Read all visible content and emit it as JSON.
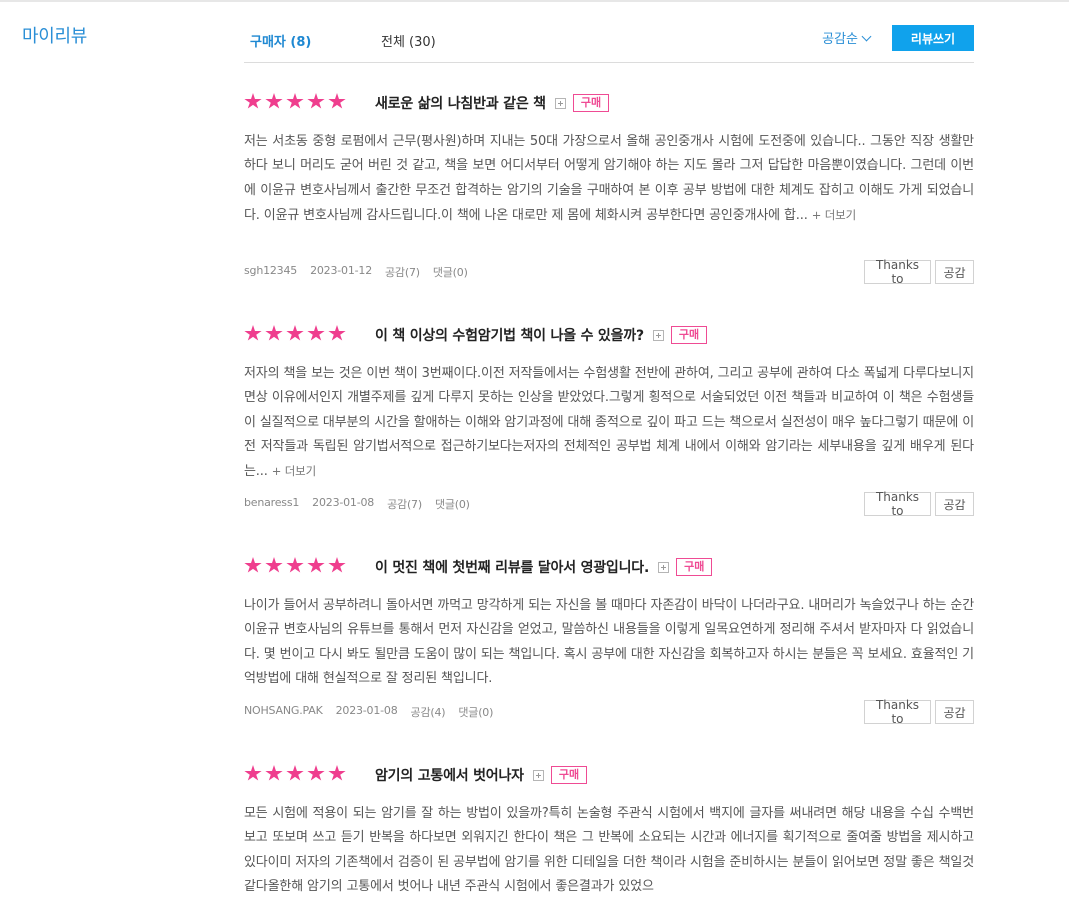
{
  "sidebar": {
    "title": "마이리뷰"
  },
  "tabs": [
    {
      "label": "구매자 (8)"
    },
    {
      "label": "전체 (30)"
    }
  ],
  "sort_label": "공감순",
  "write_button": "리뷰쓰기",
  "buttons": {
    "thanks": "Thanks to",
    "like": "공감"
  },
  "more_label": "+ 더보기",
  "colors": {
    "accent": "#10a2ec",
    "link": "#2b8fd6",
    "star": "#ef3e8e",
    "badge": "#ef4b94"
  },
  "reviews": [
    {
      "rating": 5,
      "title": "새로운 삶의 나침반과 같은 책",
      "badge": "구매",
      "body": "저는 서초동 중형 로펌에서 근무(평사원)하며 지내는 50대 가장으로서 올해 공인중개사 시험에 도전중에 있습니다.. 그동안 직장 생활만 하다 보니 머리도 굳어 버린 것 같고, 책을 보면 어디서부터 어떻게 암기해야 하는 지도 몰라 그저 답답한 마음뿐이였습니다. 그런데 이번에 이윤규 변호사님께서 출간한 무조건 합격하는 암기의 기술을 구매하여 본 이후 공부 방법에 대한 체계도 잡히고 이해도 가게 되었습니다. 이윤규 변호사님께 감사드립니다.이 책에 나온 대로만 제 몸에 체화시켜 공부한다면 공인중개사에 합...",
      "has_more": true,
      "author": "sgh12345",
      "date": "2023-01-12",
      "likes": "공감(7)",
      "comments": "댓글(0)"
    },
    {
      "rating": 5,
      "title": "이 책 이상의 수험암기법 책이 나올 수 있을까?",
      "badge": "구매",
      "body": "저자의 책을 보는 것은 이번 책이 3번째이다.이전 저작들에서는 수험생활 전반에 관하여, 그리고 공부에 관하여 다소 폭넓게 다루다보니지면상 이유에서인지 개별주제를 깊게 다루지 못하는 인상을 받았었다.그렇게 횡적으로 서술되었던 이전 책들과 비교하여 이 책은 수험생들이 실질적으로 대부분의 시간을 할애하는 이해와 암기과정에 대해 종적으로 깊이 파고 드는 책으로서 실전성이 매우 높다그렇기 때문에 이전 저작들과 독립된 암기법서적으로 접근하기보다는저자의 전체적인 공부법 체계 내에서 이해와 암기라는 세부내용을 깊게 배우게 된다는...",
      "has_more": true,
      "author": "benaress1",
      "date": "2023-01-08",
      "likes": "공감(7)",
      "comments": "댓글(0)"
    },
    {
      "rating": 5,
      "title": "이 멋진 책에 첫번째 리뷰를 달아서 영광입니다.",
      "badge": "구매",
      "body": "나이가 들어서 공부하려니 돌아서면 까먹고 망각하게 되는 자신을 볼 때마다 자존감이 바닥이 나더라구요. 내머리가 녹슬었구나 하는 순간 이윤규 변호사님의 유튜브를 통해서 먼저 자신감을 얻었고, 말씀하신 내용들을 이렇게 일목요연하게 정리해 주셔서 받자마자 다 읽었습니다. 몇 번이고 다시 봐도 될만큼 도움이 많이 되는 책입니다. 혹시 공부에 대한 자신감을 회복하고자 하시는 분들은 꼭 보세요. 효율적인 기억방법에 대해 현실적으로 잘 정리된 책입니다.",
      "has_more": false,
      "author": "NOHSANG.PAK",
      "date": "2023-01-08",
      "likes": "공감(4)",
      "comments": "댓글(0)"
    },
    {
      "rating": 5,
      "title": "암기의 고통에서 벗어나자",
      "badge": "구매",
      "body": "모든 시험에 적용이 되는 암기를 잘 하는 방법이 있을까?특히 논술형 주관식 시험에서 백지에 글자를 써내려면 해당 내용을 수십 수백번 보고 또보며 쓰고 듣기 반복을 하다보면 외워지긴 한다이 책은 그 반복에 소요되는 시간과 에너지를 획기적으로 줄여줄 방법을 제시하고 있다이미 저자의 기존책에서 검증이 된 공부법에 암기를 위한 디테일을 더한 책이라 시험을 준비하시는 분들이 읽어보면 정말 좋은 책일것 같다올한해 암기의 고통에서 벗어나 내년 주관식 시험에서 좋은결과가 있었으",
      "has_more": false,
      "author": "",
      "date": "",
      "likes": "",
      "comments": ""
    }
  ]
}
